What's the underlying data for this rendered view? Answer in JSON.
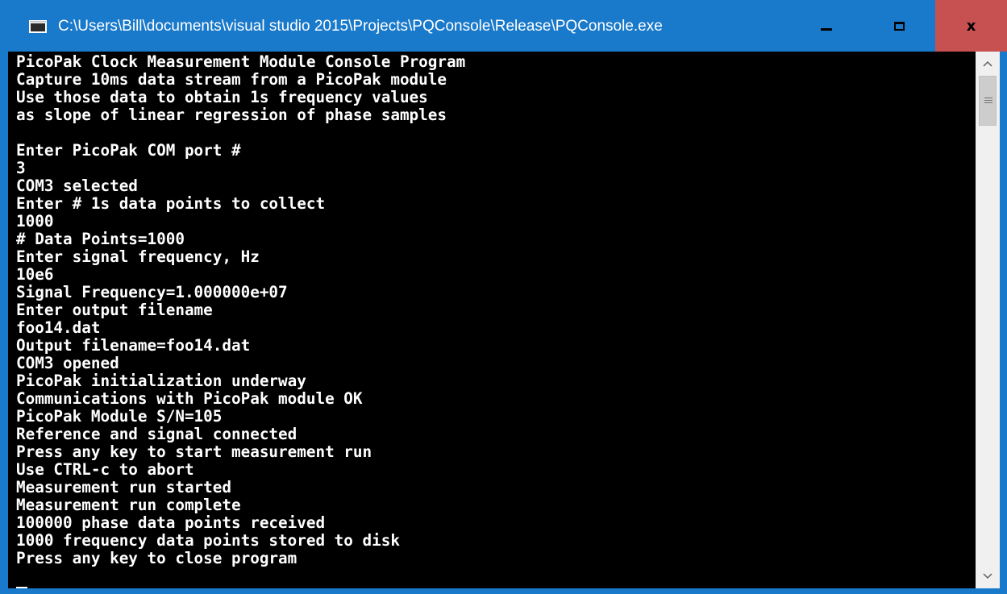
{
  "window": {
    "title": "C:\\Users\\Bill\\documents\\visual studio 2015\\Projects\\PQConsole\\Release\\PQConsole.exe",
    "close_glyph": "x"
  },
  "console": {
    "lines": [
      "PicoPak Clock Measurement Module Console Program",
      "Capture 10ms data stream from a PicoPak module",
      "Use those data to obtain 1s frequency values",
      "as slope of linear regression of phase samples",
      "",
      "Enter PicoPak COM port #",
      "3",
      "COM3 selected",
      "Enter # 1s data points to collect",
      "1000",
      "# Data Points=1000",
      "Enter signal frequency, Hz",
      "10e6",
      "Signal Frequency=1.000000e+07",
      "Enter output filename",
      "foo14.dat",
      "Output filename=foo14.dat",
      "COM3 opened",
      "PicoPak initialization underway",
      "Communications with PicoPak module OK",
      "PicoPak Module S/N=105",
      "Reference and signal connected",
      "Press any key to start measurement run",
      "Use CTRL-c to abort",
      "Measurement run started",
      "Measurement run complete",
      "100000 phase data points received",
      "1000 frequency data points stored to disk",
      "Press any key to close program"
    ]
  },
  "scrollbar": {
    "up_glyph": "^",
    "down_glyph": "v"
  },
  "colors": {
    "titlebar": "#1979ca",
    "close_hover": "#c75050",
    "console_bg": "#000000",
    "console_fg": "#ffffff",
    "scrollbar_bg": "#f0f0f0"
  }
}
